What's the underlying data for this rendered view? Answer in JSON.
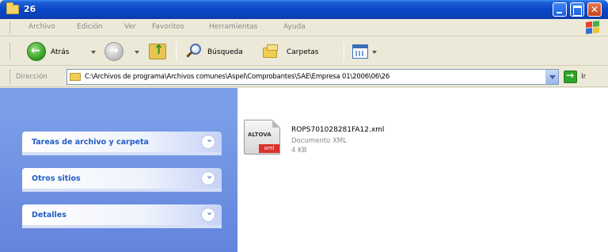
{
  "window": {
    "title": "26"
  },
  "menu": {
    "items": [
      "Archivo",
      "Edición",
      "Ver",
      "Favoritos",
      "Herramientas",
      "Ayuda"
    ]
  },
  "toolbar": {
    "back_label": "Atrás",
    "search_label": "Búsqueda",
    "folders_label": "Carpetas"
  },
  "address": {
    "label": "Dirección",
    "path": "C:\\Archivos de programa\\Archivos comunes\\Aspel\\Comprobantes\\SAE\\Empresa 01\\2006\\06\\26",
    "go_label": "Ir"
  },
  "sidebar": {
    "panels": [
      {
        "title": "Tareas de archivo y carpeta"
      },
      {
        "title": "Otros sitios"
      },
      {
        "title": "Detalles"
      }
    ]
  },
  "files": [
    {
      "name": "ROPS701028281FA12.xml",
      "type": "Documento XML",
      "size": "4 KB",
      "icon_brand": "ALTOVA",
      "icon_ext": "xml"
    }
  ],
  "colors": {
    "title_bar": "#0b47c9",
    "task_pane": "#7a9ee8",
    "panel_title": "#215dc6",
    "close_button": "#c6401c"
  }
}
